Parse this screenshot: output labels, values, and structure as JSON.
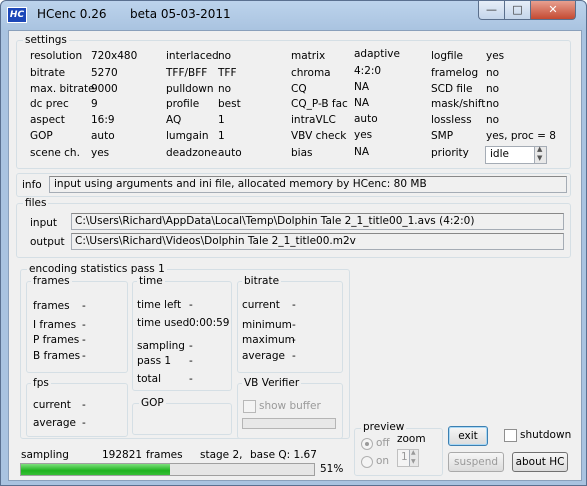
{
  "window": {
    "app_title": "HCenc 0.26",
    "beta": "beta 05-03-2011",
    "logo": "HC",
    "minimize_icon": "minimize-icon",
    "maximize_icon": "maximize-icon",
    "close_icon": "close-icon"
  },
  "settings": {
    "title": "settings",
    "col1": [
      {
        "label": "resolution",
        "value": "720x480"
      },
      {
        "label": "bitrate",
        "value": "5270"
      },
      {
        "label": "max. bitrate",
        "value": "9000"
      },
      {
        "label": "dc prec",
        "value": "9"
      },
      {
        "label": "aspect",
        "value": "16:9"
      },
      {
        "label": "GOP",
        "value": "auto"
      },
      {
        "label": "scene ch.",
        "value": "yes"
      }
    ],
    "col2": [
      {
        "label": "interlaced",
        "value": "no"
      },
      {
        "label": "TFF/BFF",
        "value": "TFF"
      },
      {
        "label": "pulldown",
        "value": "no"
      },
      {
        "label": "profile",
        "value": "best"
      },
      {
        "label": "AQ",
        "value": "1"
      },
      {
        "label": "lumgain",
        "value": "1"
      },
      {
        "label": "deadzone",
        "value": "auto"
      }
    ],
    "col3": [
      {
        "label": "matrix",
        "value": "adaptive"
      },
      {
        "label": "chroma",
        "value": "4:2:0"
      },
      {
        "label": "CQ",
        "value": "NA"
      },
      {
        "label": "CQ_P-B fac",
        "value": "NA"
      },
      {
        "label": "intraVLC",
        "value": "auto"
      },
      {
        "label": "VBV check",
        "value": "yes"
      },
      {
        "label": "bias",
        "value": "NA"
      }
    ],
    "col4": [
      {
        "label": "logfile",
        "value": "yes"
      },
      {
        "label": "framelog",
        "value": "no"
      },
      {
        "label": "SCD file",
        "value": "no"
      },
      {
        "label": "mask/shift",
        "value": "no"
      },
      {
        "label": "lossless",
        "value": "no"
      },
      {
        "label": "SMP",
        "value": "yes,  proc = 8"
      },
      {
        "label": "priority",
        "value": "idle"
      }
    ]
  },
  "info": {
    "label": "info",
    "text": "input using arguments and ini file,  allocated memory by HCenc:   80 MB"
  },
  "files": {
    "title": "files",
    "input_label": "input",
    "input_value": "C:\\Users\\Richard\\AppData\\Local\\Temp\\Dolphin Tale 2_1_title00_1.avs  (4:2:0)",
    "output_label": "output",
    "output_value": "C:\\Users\\Richard\\Videos\\Dolphin Tale 2_1_title00.m2v"
  },
  "stats": {
    "title": "encoding statistics pass 1",
    "frames": {
      "title": "frames",
      "rows": [
        {
          "label": "frames",
          "value": "-"
        },
        {
          "label": "I frames",
          "value": "-"
        },
        {
          "label": "P frames",
          "value": "-"
        },
        {
          "label": "B frames",
          "value": "-"
        }
      ]
    },
    "time": {
      "title": "time",
      "rows": [
        {
          "label": "time left",
          "value": "-"
        },
        {
          "label": "time used",
          "value": "0:00:59"
        },
        {
          "label": "sampling",
          "value": "-"
        },
        {
          "label": "pass 1",
          "value": "-"
        },
        {
          "label": "total",
          "value": "-"
        }
      ]
    },
    "bitrate": {
      "title": "bitrate",
      "rows": [
        {
          "label": "current",
          "value": "-"
        },
        {
          "label": "minimum",
          "value": "-"
        },
        {
          "label": "maximum",
          "value": "-"
        },
        {
          "label": "average",
          "value": "-"
        }
      ]
    },
    "fps": {
      "title": "fps",
      "rows": [
        {
          "label": "current",
          "value": "-"
        },
        {
          "label": "average",
          "value": "-"
        }
      ]
    },
    "gop": {
      "title": "GOP"
    },
    "vb": {
      "title": "VB Verifier",
      "show_buffer": "show buffer"
    }
  },
  "preview": {
    "title": "preview",
    "off": "off",
    "on": "on",
    "zoom_label": "zoom",
    "zoom_value": "1"
  },
  "buttons": {
    "exit": "exit",
    "suspend": "suspend",
    "about": "about  HC",
    "shutdown": "shutdown"
  },
  "status": {
    "phase": "sampling",
    "frames_count": "192821",
    "frames_label": "frames",
    "stage": "stage 2,",
    "baseq": "base Q: 1.67",
    "percent": "51%",
    "progress": 0.51
  }
}
